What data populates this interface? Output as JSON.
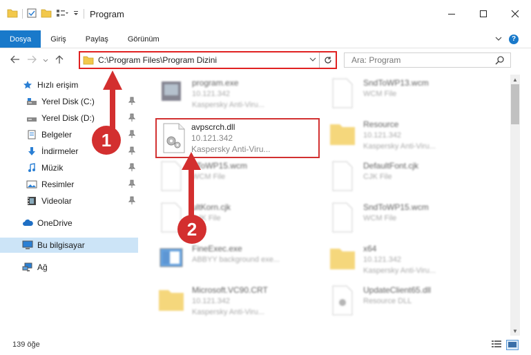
{
  "window": {
    "title": "Program"
  },
  "ribbon": {
    "tabs": [
      {
        "label": "Dosya",
        "active": true
      },
      {
        "label": "Giriş"
      },
      {
        "label": "Paylaş"
      },
      {
        "label": "Görünüm"
      }
    ],
    "help_label": "?"
  },
  "address": {
    "path": "C:\\Program Files\\Program Dizini"
  },
  "search": {
    "placeholder": "Ara: Program"
  },
  "sidebar": {
    "items": [
      {
        "label": "Hızlı erişim",
        "icon": "star-icon"
      },
      {
        "label": "Yerel Disk (C:)",
        "icon": "drive-icon",
        "pinned": true
      },
      {
        "label": "Yerel Disk (D:)",
        "icon": "drive-icon",
        "pinned": true
      },
      {
        "label": "Belgeler",
        "icon": "documents-icon",
        "pinned": true
      },
      {
        "label": "İndirmeler",
        "icon": "download-icon",
        "pinned": true
      },
      {
        "label": "Müzik",
        "icon": "music-icon",
        "pinned": true
      },
      {
        "label": "Resimler",
        "icon": "pictures-icon",
        "pinned": true
      },
      {
        "label": "Videolar",
        "icon": "videos-icon",
        "pinned": true
      },
      {
        "label": "OneDrive",
        "icon": "cloud-icon"
      },
      {
        "label": "Bu bilgisayar",
        "icon": "computer-icon",
        "selected": true
      },
      {
        "label": "Ağ",
        "icon": "network-icon"
      }
    ]
  },
  "files": [
    {
      "name": "program.exe",
      "version": "10.121.342",
      "desc": "Kaspersky Anti-Viru..."
    },
    {
      "name": "SndToWP13.wcm",
      "version": "",
      "desc": "WCM File"
    },
    {
      "name": "Resource",
      "version": "10.121.342",
      "desc": "Kaspersky Anti-Viru..."
    },
    {
      "name": "dToWP15.wcm",
      "version": "",
      "desc": "WCM File"
    },
    {
      "name": "DefaultFont.cjk",
      "version": "",
      "desc": "CJK File"
    },
    {
      "name": "ultKorn.cjk",
      "version": "",
      "desc": "CJK File"
    },
    {
      "name": "SndToWP15.wcm",
      "version": "",
      "desc": "WCM File"
    },
    {
      "name": "FineExec.exe",
      "version": "",
      "desc": "ABBYY background exe..."
    },
    {
      "name": "x64",
      "version": "10.121.342",
      "desc": "Kaspersky Anti-Viru..."
    },
    {
      "name": "Microsoft.VC90.CRT",
      "version": "10.121.342",
      "desc": "Kaspersky Anti-Viru..."
    },
    {
      "name": "UpdateClient65.dll",
      "version": "",
      "desc": "Resource DLL"
    }
  ],
  "featured": {
    "name": "avpscrch.dll",
    "version": "10.121.342",
    "desc": "Kaspersky Anti-Viru..."
  },
  "status": {
    "count": "139 öğe"
  },
  "callouts": [
    "1",
    "2"
  ],
  "colors": {
    "accent": "#1979ca",
    "highlight": "#d32f2f",
    "selected": "#cce4f7",
    "folder": "#f2c84b"
  }
}
